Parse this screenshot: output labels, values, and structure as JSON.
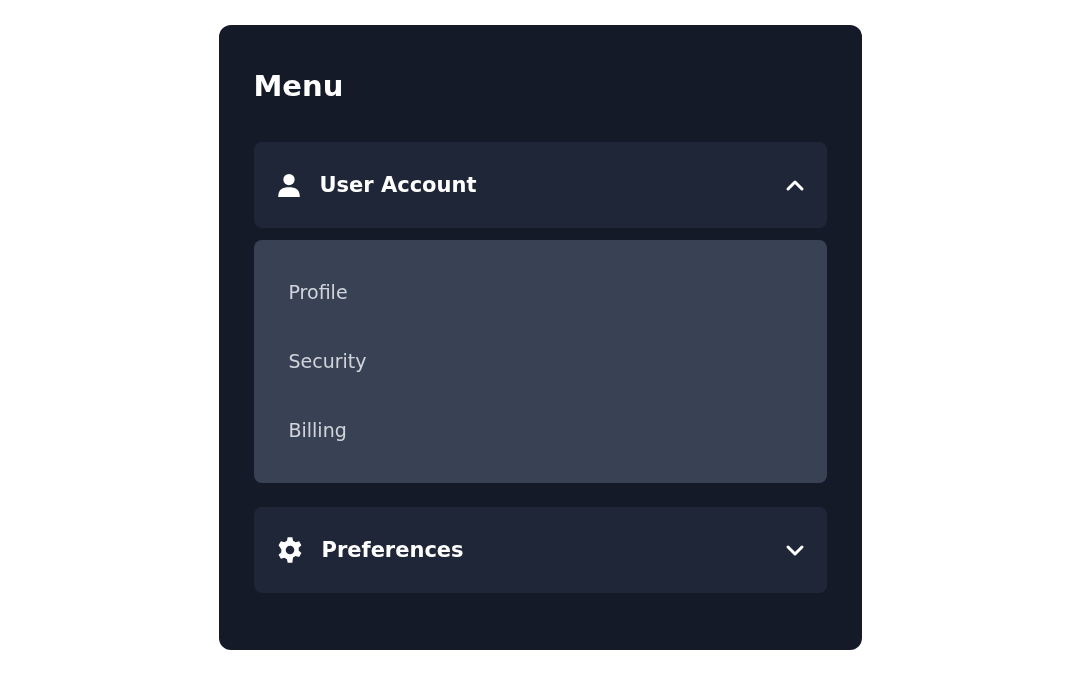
{
  "title": "Menu",
  "sections": [
    {
      "label": "User Account",
      "expanded": true,
      "items": [
        "Profile",
        "Security",
        "Billing"
      ]
    },
    {
      "label": "Preferences",
      "expanded": false
    }
  ]
}
